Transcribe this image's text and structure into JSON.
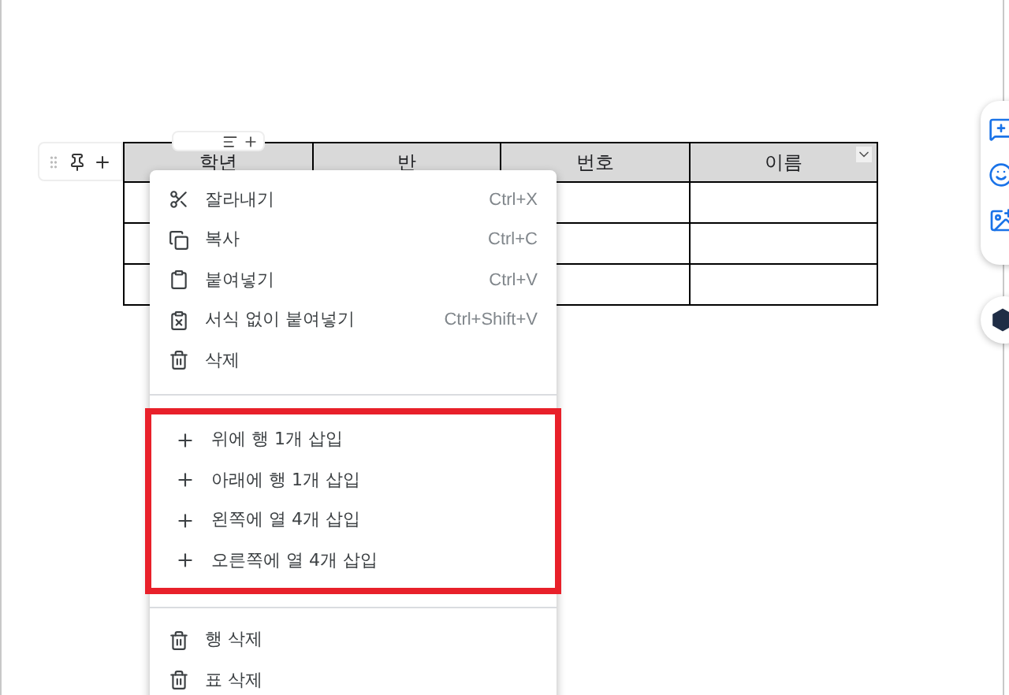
{
  "table": {
    "columns": [
      "학년",
      "반",
      "번호",
      "이름"
    ]
  },
  "menu": {
    "groups": [
      {
        "highlighted": false,
        "items": [
          {
            "label": "잘라내기",
            "shortcut": "Ctrl+X"
          },
          {
            "label": "복사",
            "shortcut": "Ctrl+C"
          },
          {
            "label": "붙여넣기",
            "shortcut": "Ctrl+V"
          },
          {
            "label": "서식 없이 붙여넣기",
            "shortcut": "Ctrl+Shift+V"
          },
          {
            "label": "삭제"
          }
        ]
      },
      {
        "highlighted": true,
        "items": [
          {
            "label": "위에 행 1개 삽입"
          },
          {
            "label": "아래에 행 1개 삽입"
          },
          {
            "label": "왼쪽에 열 4개 삽입"
          },
          {
            "label": "오른쪽에 열 4개 삽입"
          }
        ]
      },
      {
        "highlighted": false,
        "items": [
          {
            "label": "행 삭제"
          },
          {
            "label": "표 삭제"
          }
        ]
      }
    ]
  }
}
